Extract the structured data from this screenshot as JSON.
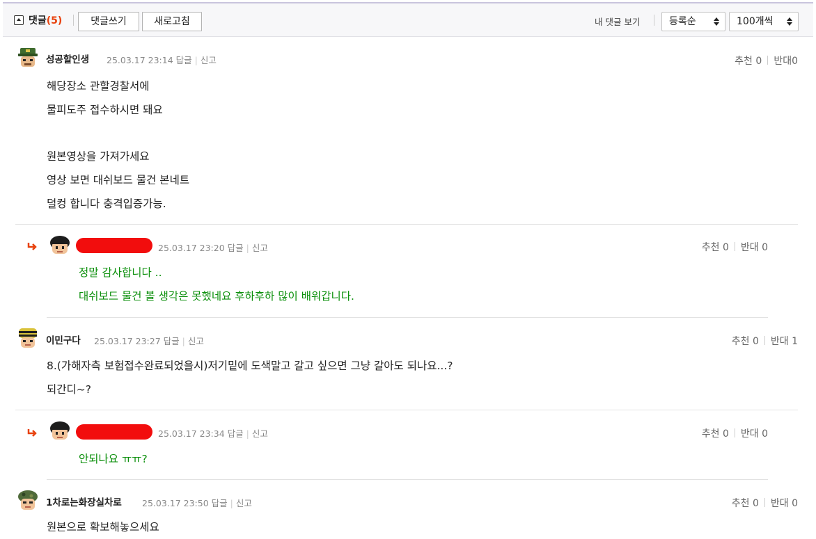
{
  "toolbar": {
    "title": "댓글",
    "count": "(5)",
    "write_label": "댓글쓰기",
    "refresh_label": "새로고침",
    "my_comments_label": "내 댓글 보기",
    "sort_selected": "등록순",
    "page_size_selected": "100개씩"
  },
  "labels": {
    "reply": "답글",
    "report": "신고",
    "recommend": "추천",
    "oppose": "반대"
  },
  "comments": [
    {
      "nickname": "성공할인생",
      "datetime": "25.03.17 23:14",
      "recommend": "0",
      "oppose": "0",
      "lines": [
        "해당장소 관할경찰서에",
        "물피도주 접수하시면 돼요",
        "",
        "원본영상을 가져가세요",
        "영상 보면 대쉬보드 물건 본네트",
        "덜컹 합니다 충격입증가능."
      ]
    },
    {
      "nickname": "",
      "datetime": "25.03.17 23:20",
      "recommend": "0",
      "oppose": "0",
      "lines": [
        "정말 감사합니다 ..",
        "대쉬보드 물건 볼 생각은 못했네요 후하후하 많이 배워갑니다."
      ]
    },
    {
      "nickname": "이민구다",
      "datetime": "25.03.17 23:27",
      "recommend": "0",
      "oppose": "1",
      "lines": [
        "8.(가해자측 보험접수완료되었을시)저기밑에 도색말고 갈고 싶으면 그냥 갈아도 되나요...?",
        "되간디~?"
      ]
    },
    {
      "nickname": "",
      "datetime": "25.03.17 23:34",
      "recommend": "0",
      "oppose": "0",
      "lines": [
        "안되나요 ㅠㅠ?"
      ]
    },
    {
      "nickname": "1차로는화장실차로",
      "datetime": "25.03.17 23:50",
      "recommend": "0",
      "oppose": "0",
      "lines": [
        "원본으로 확보해놓으세요"
      ]
    }
  ],
  "colors": {
    "accent_count": "#e8410c",
    "reply_text": "#0b8f0b",
    "redaction": "#f20d0d",
    "reply_arrow": "#e8410c"
  }
}
